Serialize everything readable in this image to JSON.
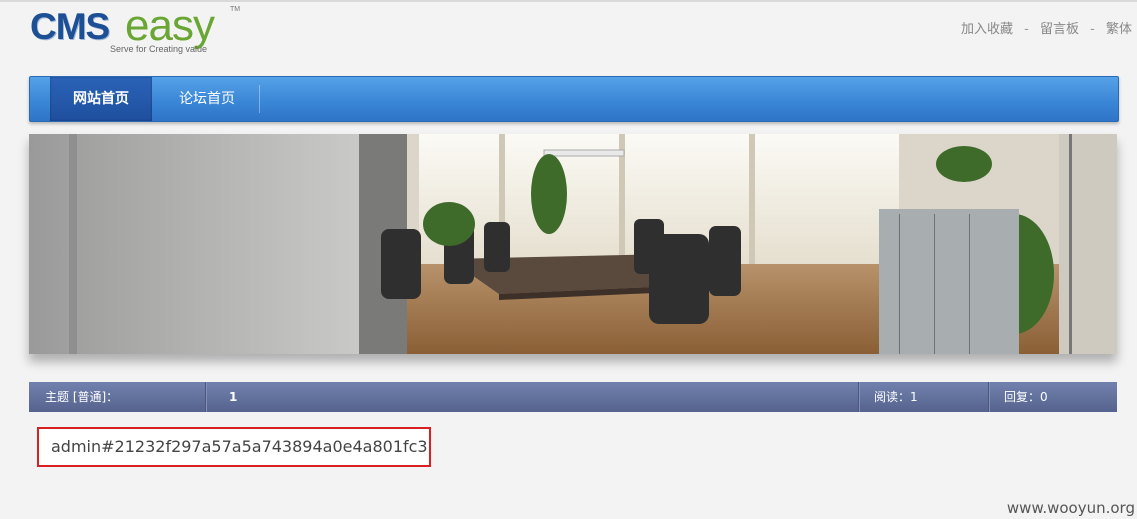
{
  "logo": {
    "cms": "CMS",
    "easy": "easy",
    "tm": "TM",
    "slogan": "Serve for Creating value"
  },
  "top_links": [
    "加入收藏",
    "留言板",
    "繁体"
  ],
  "top_link_separator": "-",
  "nav": {
    "items": [
      "网站首页",
      "论坛首页"
    ],
    "active_index": 0
  },
  "topic": {
    "label": "主题 [普通]：",
    "value": "1",
    "reads": "阅读：1",
    "replies": "回复：0"
  },
  "post_content": "admin#21232f297a57a5a743894a0e4a801fc3",
  "watermark": "www.wooyun.org",
  "colors": {
    "nav_blue": "#3b87d7",
    "topic_bar": "#5f6c98",
    "highlight_border": "#d82020"
  }
}
